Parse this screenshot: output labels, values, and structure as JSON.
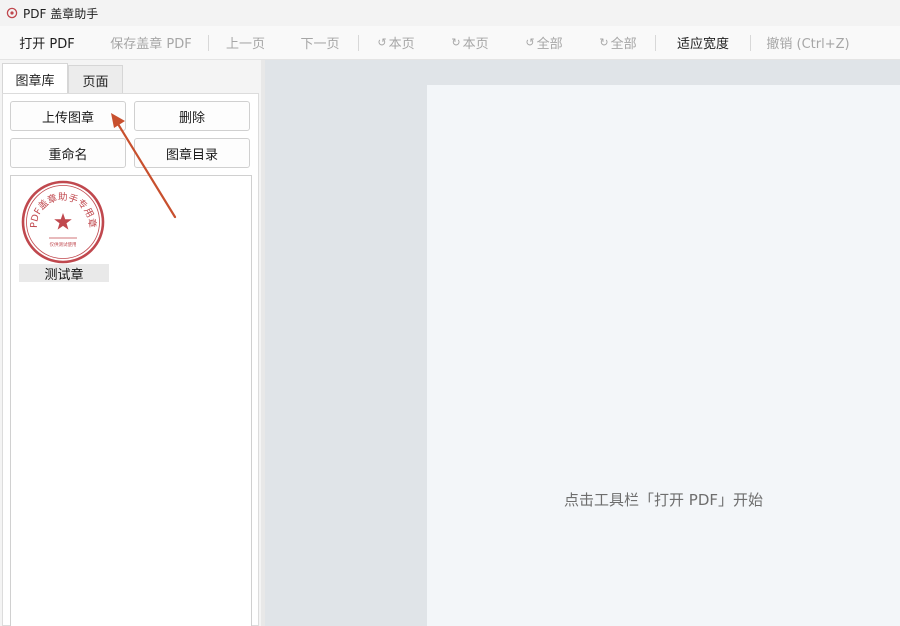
{
  "window": {
    "title": "PDF 盖章助手"
  },
  "toolbar": {
    "open_pdf": "打开 PDF",
    "save_stamped_pdf": "保存盖章 PDF",
    "prev_page": "上一页",
    "next_page": "下一页",
    "rotate_page_ccw": "本页",
    "rotate_page_cw": "本页",
    "rotate_all_ccw": "全部",
    "rotate_all_cw": "全部",
    "fit_width": "适应宽度",
    "undo": "撤销 (Ctrl+Z)"
  },
  "left_panel": {
    "tabs": [
      {
        "label": "图章库",
        "active": true
      },
      {
        "label": "页面",
        "active": false
      }
    ],
    "buttons": {
      "upload_seal": "上传图章",
      "delete": "删除",
      "rename": "重命名",
      "seal_directory": "图章目录"
    },
    "seals": [
      {
        "name": "测试章",
        "ring_text": "PDF盖章助手专用章",
        "bottom_text": "仅供测试使用"
      }
    ]
  },
  "canvas": {
    "hint": "点击工具栏「打开 PDF」开始"
  },
  "colors": {
    "seal_red": "#c0484e",
    "annotation_arrow": "#c8502e"
  }
}
